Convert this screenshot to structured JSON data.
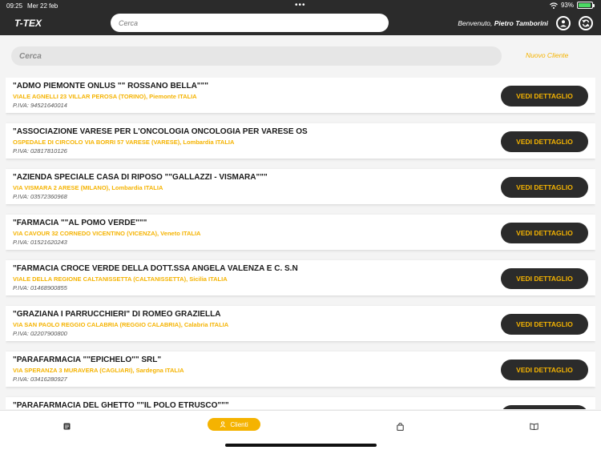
{
  "status_bar": {
    "time": "09:25",
    "date": "Mer 22 feb",
    "battery": "93%",
    "battery_level": 0.93
  },
  "header": {
    "logo": "T-TEX",
    "search_placeholder": "Cerca",
    "welcome_prefix": "Benvenuto, ",
    "user_name": "Pietro Tamborini"
  },
  "search": {
    "placeholder": "Cerca"
  },
  "new_client_label": "Nuovo Cliente",
  "clients": [
    {
      "name": "\"ADMO PIEMONTE ONLUS \"\" ROSSANO BELLA\"\"\"",
      "address": "VIALE AGNELLI 23 VILLAR PEROSA (TORINO), Piemonte ITALIA",
      "piva": "P.IVA: 94521640014",
      "button": "VEDI DETTAGLIO"
    },
    {
      "name": "\"ASSOCIAZIONE VARESE PER L'ONCOLOGIA ONCOLOGIA PER VARESE OS",
      "address": "OSPEDALE DI CIRCOLO VIA BORRI 57 VARESE (VARESE), Lombardia ITALIA",
      "piva": "P.IVA: 02817810126",
      "button": "VEDI DETTAGLIO"
    },
    {
      "name": "\"AZIENDA SPECIALE CASA DI RIPOSO \"\"GALLAZZI - VISMARA\"\"\"",
      "address": "VIA VISMARA 2 ARESE (MILANO), Lombardia ITALIA",
      "piva": "P.IVA: 03572360968",
      "button": "VEDI DETTAGLIO"
    },
    {
      "name": "\"FARMACIA \"\"AL POMO VERDE\"\"\"",
      "address": "VIA CAVOUR 32 CORNEDO VICENTINO (VICENZA), Veneto ITALIA",
      "piva": "P.IVA: 01521620243",
      "button": "VEDI DETTAGLIO"
    },
    {
      "name": "\"FARMACIA CROCE VERDE DELLA DOTT.SSA ANGELA VALENZA E C. S.N",
      "address": "VIALE DELLA REGIONE CALTANISSETTA (CALTANISSETTA), Sicilia ITALIA",
      "piva": "P.IVA: 01468900855",
      "button": "VEDI DETTAGLIO"
    },
    {
      "name": "\"GRAZIANA I PARRUCCHIERI\" DI ROMEO GRAZIELLA",
      "address": "VIA SAN PAOLO REGGIO CALABRIA (REGGIO CALABRIA), Calabria ITALIA",
      "piva": "P.IVA: 02207900800",
      "button": "VEDI DETTAGLIO"
    },
    {
      "name": "\"PARAFARMACIA \"\"EPICHELO\"\" SRL\"",
      "address": "VIA SPERANZA 3 MURAVERA (CAGLIARI), Sardegna ITALIA",
      "piva": "P.IVA: 03416280927",
      "button": "VEDI DETTAGLIO"
    },
    {
      "name": "\"PARAFARMACIA DEL GHETTO \"\"IL POLO ETRUSCO\"\"\"",
      "address": "",
      "piva": "",
      "button": ""
    }
  ],
  "tabs": {
    "active_label": "Clienti"
  },
  "icons": {
    "tab_1": "document-icon",
    "tab_2": "user-icon",
    "tab_3": "shopping-bag-icon",
    "tab_4": "book-icon"
  },
  "colors": {
    "accent": "#f5b301",
    "dark": "#2b2b2b"
  }
}
